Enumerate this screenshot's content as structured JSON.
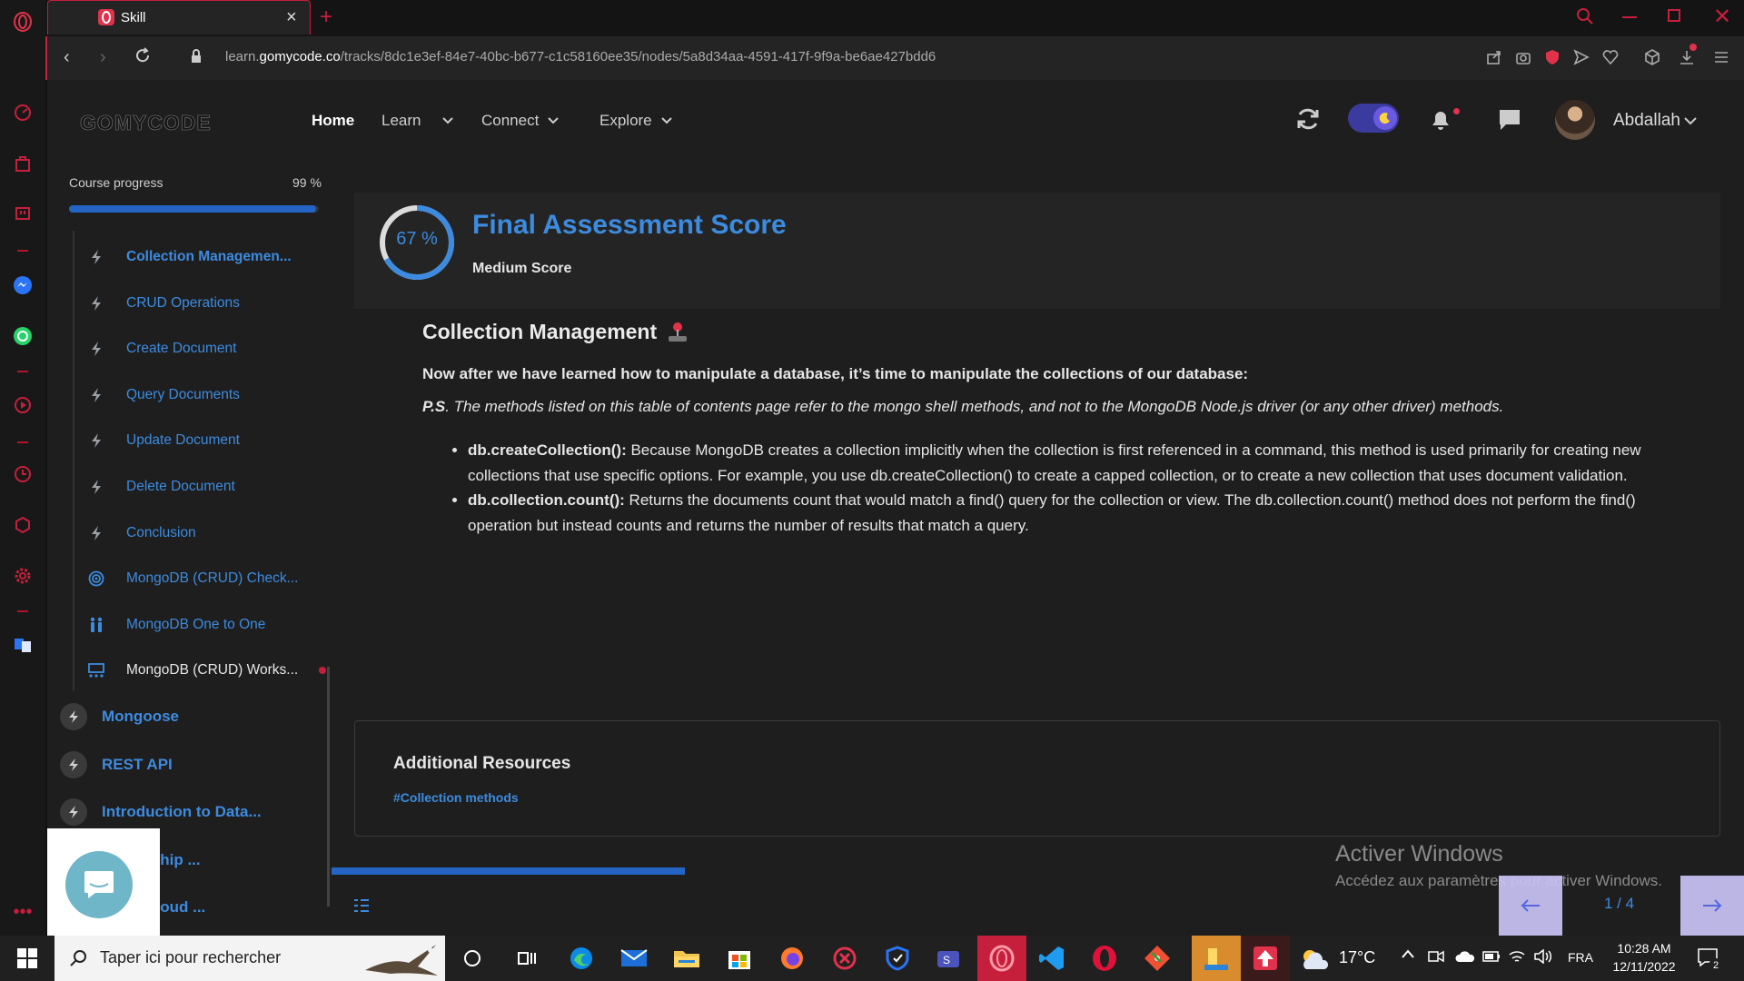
{
  "browser": {
    "tab_title": "Skill",
    "url_prefix": "learn.",
    "url_domain": "gomycode.co",
    "url_path": "/tracks/8dc1e3ef-84e7-40bc-b677-c1c58160ee35/nodes/5a8d34aa-4591-417f-9f9a-be6ae427bdd6"
  },
  "header": {
    "logo": "GOMYCODE",
    "nav": [
      "Home",
      "Learn",
      "Connect",
      "Explore"
    ],
    "user_name": "Abdallah"
  },
  "course": {
    "progress_label": "Course progress",
    "progress_value": "99 %",
    "progress_fraction": 0.99,
    "lessons": [
      {
        "label": "Collection Managemen...",
        "icon": "bolt-icon",
        "active": true
      },
      {
        "label": "CRUD Operations",
        "icon": "bolt-icon"
      },
      {
        "label": "Create Document",
        "icon": "bolt-icon"
      },
      {
        "label": "Query Documents",
        "icon": "bolt-icon"
      },
      {
        "label": "Update Document",
        "icon": "bolt-icon"
      },
      {
        "label": "Delete Document",
        "icon": "bolt-icon"
      },
      {
        "label": "Conclusion",
        "icon": "bolt-icon"
      },
      {
        "label": "MongoDB (CRUD) Check...",
        "icon": "target-icon"
      },
      {
        "label": "MongoDB One to One",
        "icon": "people-icon"
      },
      {
        "label": "MongoDB (CRUD) Works...",
        "icon": "workshop-icon"
      }
    ],
    "chapters": [
      "Mongoose",
      "REST API",
      "Introduction to Data...",
      "elationship ...",
      "ion & Cloud ..."
    ]
  },
  "score": {
    "percent_label": "67 %",
    "fraction": 0.67,
    "title": "Final Assessment Score",
    "subtitle": "Medium Score"
  },
  "content": {
    "heading": "Collection Management",
    "intro": "Now after we have learned how to manipulate a database, it’s time to manipulate the collections of our database:",
    "ps_label": "P.S",
    "ps_text": ". The methods listed on this table of contents page refer to the mongo shell methods, and not to the MongoDB Node.js driver (or any other driver) methods.",
    "bullets": [
      {
        "term": "db.createCollection():",
        "text": " Because MongoDB creates a collection implicitly when the collection is first referenced in a command, this method is used primarily for creating new collections that use specific options. For example, you use db.createCollection() to create a capped collection, or to create a new collection that uses document validation."
      },
      {
        "term": "db.collection.count():",
        "text": " Returns the documents count that would match a find() query for the collection or view. The db.collection.count() method does not perform the find() operation but instead counts and returns the number of results that match a query."
      }
    ]
  },
  "resources": {
    "title": "Additional Resources",
    "link": "#Collection methods"
  },
  "pager": {
    "label": "1 / 4",
    "fraction": 0.25
  },
  "watermark": {
    "line1": "Activer Windows",
    "line2": "Accédez aux paramètres pour activer Windows."
  },
  "taskbar": {
    "search_placeholder": "Taper ici pour rechercher",
    "weather": "17°C",
    "lang": "FRA",
    "time": "10:28 AM",
    "date": "12/11/2022",
    "notif_count": "2"
  },
  "colors": {
    "accent": "#3d8bdf",
    "opera_red": "#c51f3b",
    "pager_bg": "#c9c3f5"
  }
}
